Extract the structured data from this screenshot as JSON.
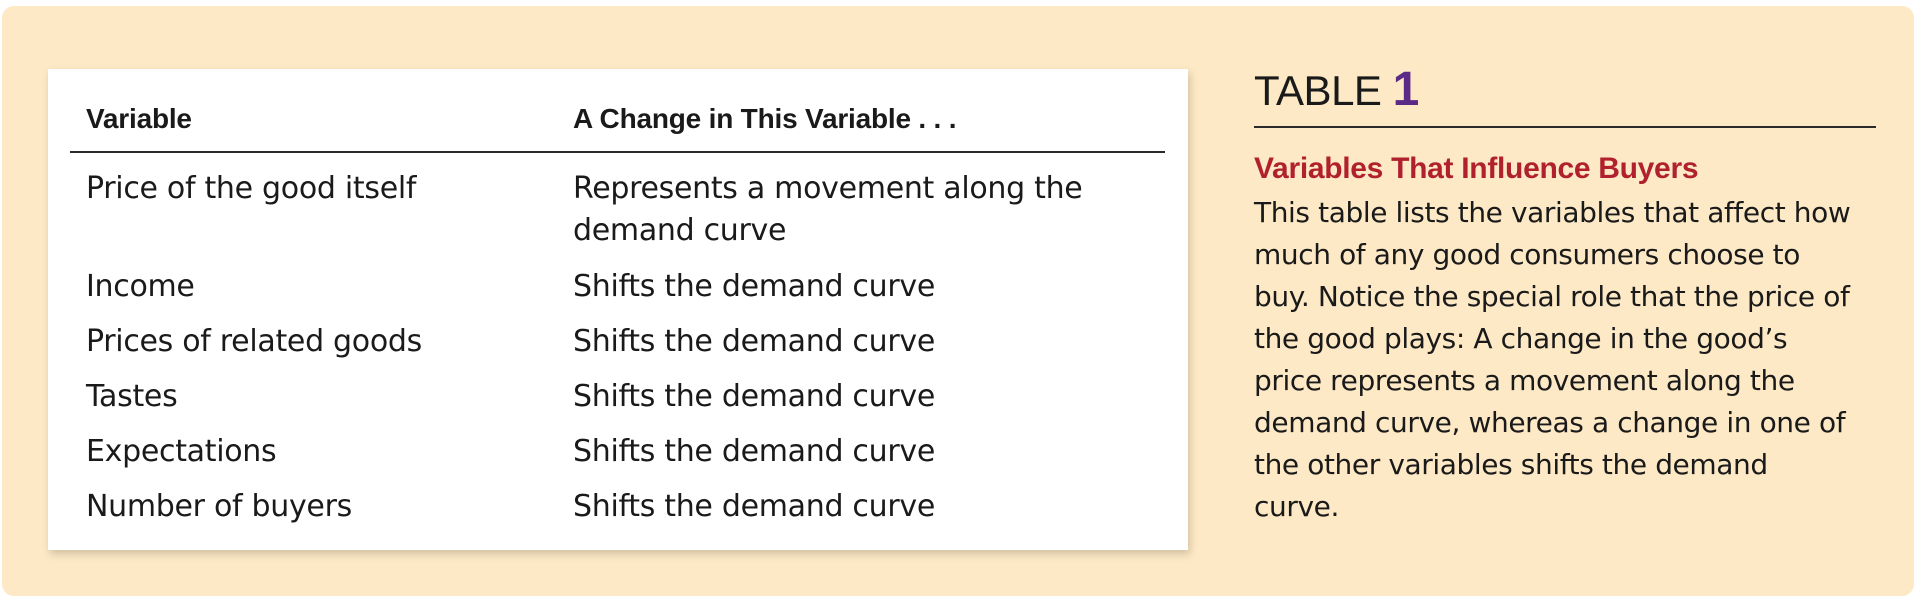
{
  "table": {
    "headers": [
      "Variable",
      "A Change in This Variable . . ."
    ],
    "rows": [
      {
        "variable": "Price of the good itself",
        "effect": "Represents a movement along the demand curve"
      },
      {
        "variable": "Income",
        "effect": "Shifts the demand curve"
      },
      {
        "variable": "Prices of related goods",
        "effect": "Shifts the demand curve"
      },
      {
        "variable": "Tastes",
        "effect": "Shifts the demand curve"
      },
      {
        "variable": "Expectations",
        "effect": "Shifts the demand curve"
      },
      {
        "variable": "Number of buyers",
        "effect": "Shifts the demand curve"
      }
    ]
  },
  "caption": {
    "label": "TABLE",
    "number": "1",
    "title": "Variables That Influence Buyers",
    "body": "This table lists the variables that affect how much of any good consumers choose to buy. Notice the special role that the price of the good plays: A change in the good’s price represents a movement along the demand curve, whereas a change in one of the other variables shifts the demand curve."
  },
  "colors": {
    "panel_background": "#fde9c5",
    "title_red": "#b0212d",
    "number_purple": "#5b2a86"
  }
}
